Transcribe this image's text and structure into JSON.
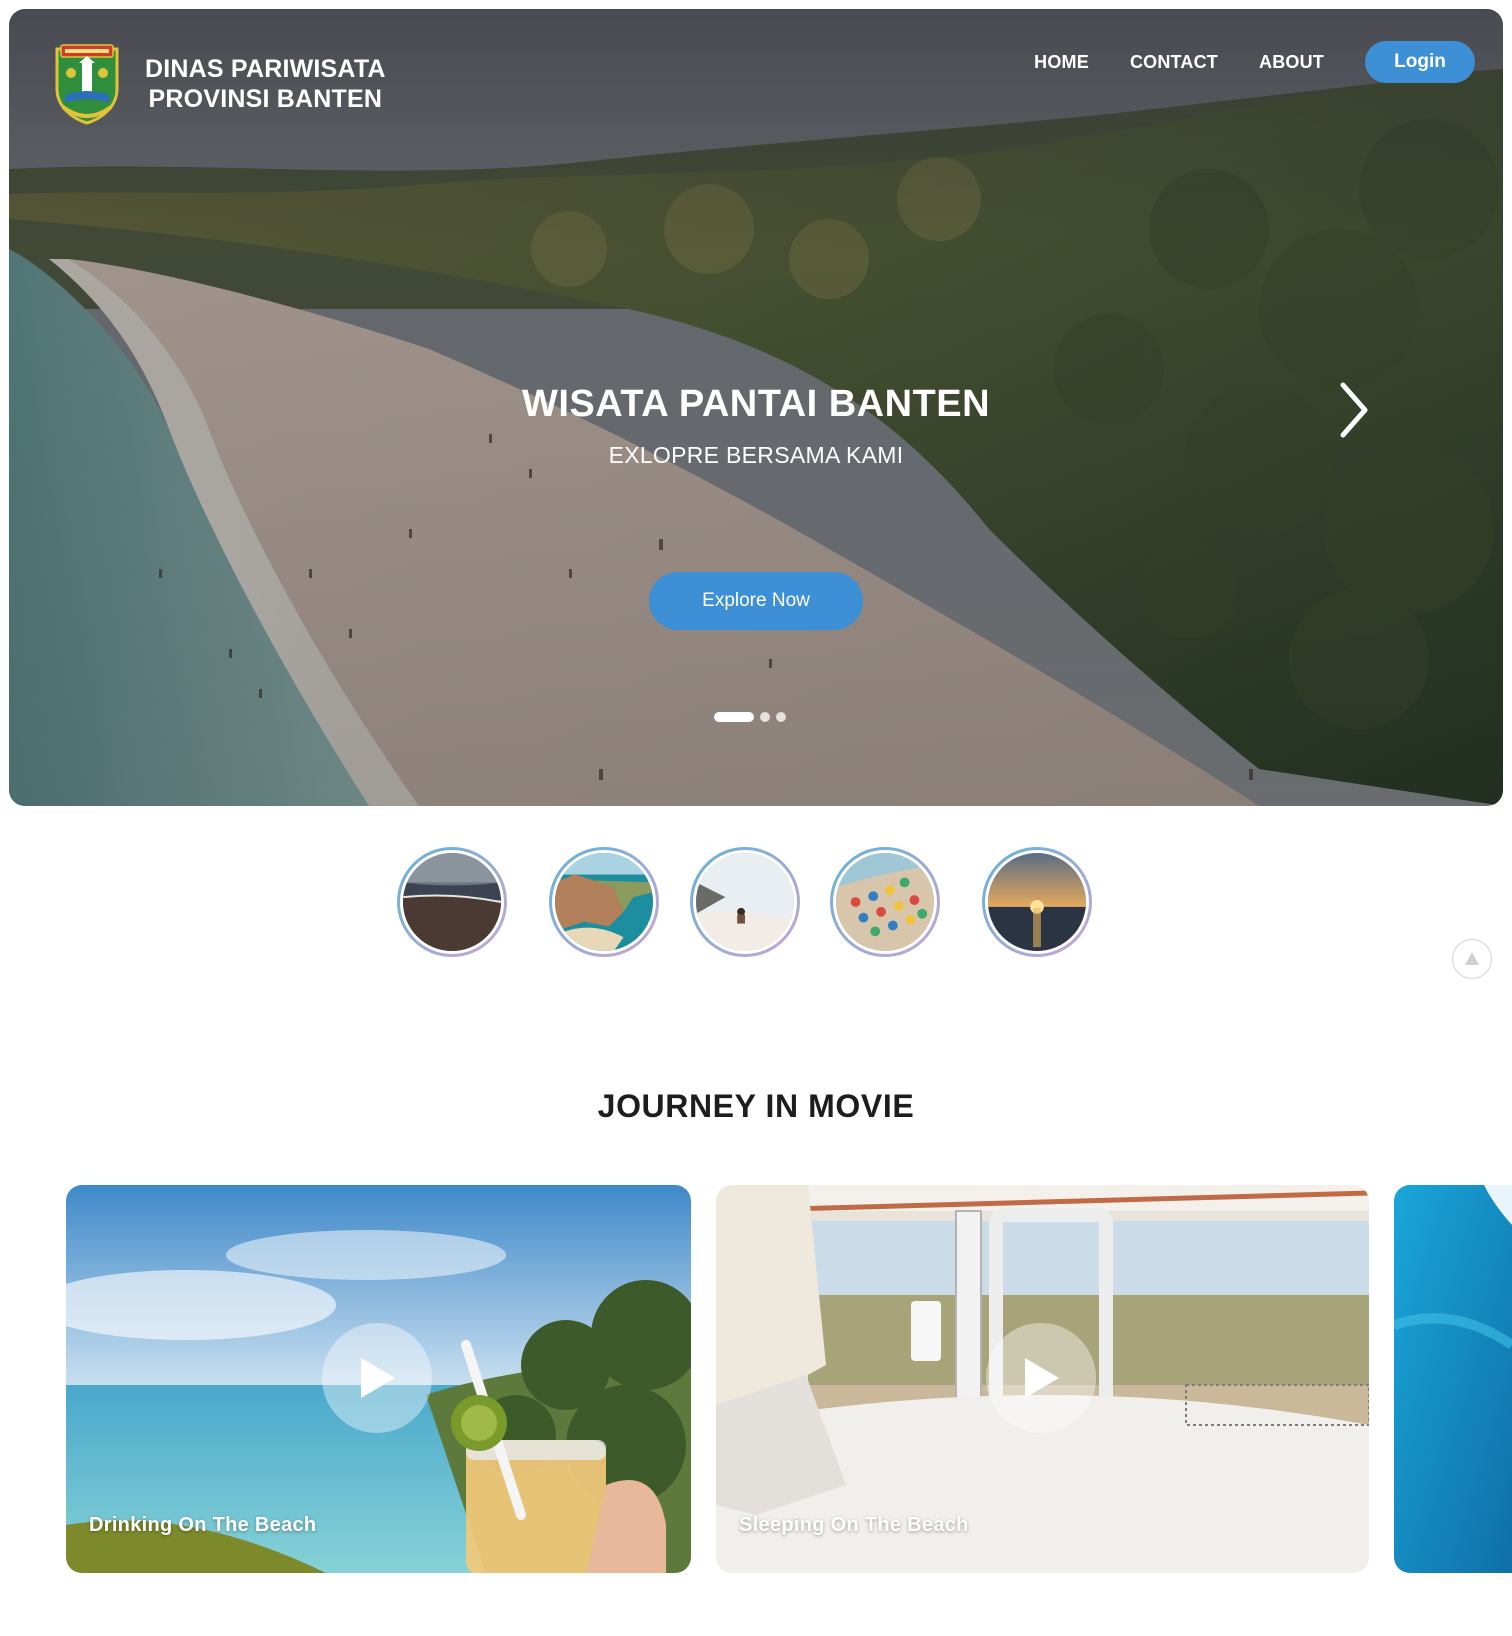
{
  "brand": {
    "line1": "DINAS PARIWISATA",
    "line2": "PROVINSI BANTEN",
    "logo_icon": "banten-crest-icon"
  },
  "nav": {
    "items": [
      {
        "label": "HOME"
      },
      {
        "label": "CONTACT"
      },
      {
        "label": "ABOUT"
      }
    ],
    "login_label": "Login"
  },
  "hero": {
    "title": "WISATA PANTAI BANTEN",
    "subtitle": "EXLOPRE BERSAMA KAMI",
    "cta_label": "Explore Now",
    "next_icon": "chevron-right-icon",
    "slides_total": 3,
    "active_slide": 1
  },
  "thumbnails": [
    {
      "name": "thumb-dark-beach"
    },
    {
      "name": "thumb-cliff-cove"
    },
    {
      "name": "thumb-person-on-dune"
    },
    {
      "name": "thumb-umbrella-beach"
    },
    {
      "name": "thumb-sunset-sea"
    }
  ],
  "scroll_top_icon": "arrow-up-icon",
  "journey": {
    "title": "JOURNEY IN MOVIE",
    "movies": [
      {
        "label": "Drinking On The Beach",
        "play_icon": "play-icon"
      },
      {
        "label": "Sleeping On The Beach",
        "play_icon": "play-icon"
      }
    ]
  },
  "colors": {
    "accent": "#3d8fd6",
    "text_dark": "#1d1d1f"
  }
}
